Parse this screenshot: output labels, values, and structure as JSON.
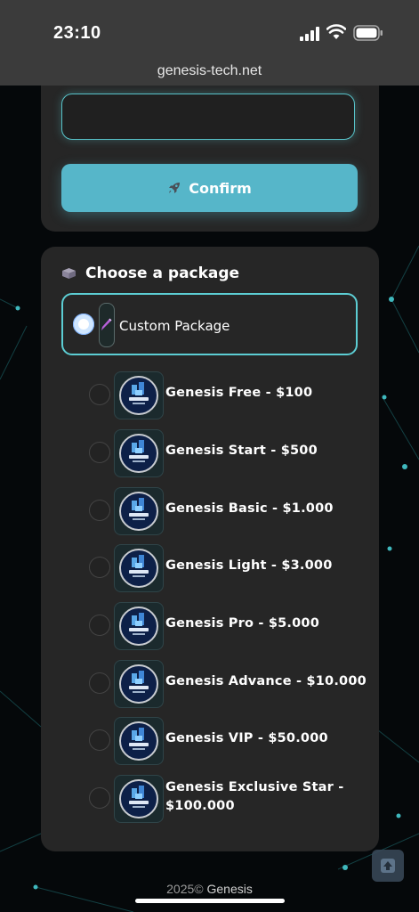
{
  "status_bar": {
    "time": "23:10"
  },
  "browser": {
    "url": "genesis-tech.net"
  },
  "form": {
    "amount_value": "",
    "confirm_label": "Confirm"
  },
  "packages": {
    "title": "Choose a package",
    "custom": {
      "label": "Custom Package",
      "selected": true
    },
    "items": [
      {
        "name": "Genesis Free - $100",
        "selected": false
      },
      {
        "name": "Genesis Start - $500",
        "selected": false
      },
      {
        "name": "Genesis Basic - $1.000",
        "selected": false
      },
      {
        "name": "Genesis Light - $3.000",
        "selected": false
      },
      {
        "name": "Genesis Pro - $5.000",
        "selected": false
      },
      {
        "name": "Genesis Advance - $10.000",
        "selected": false
      },
      {
        "name": "Genesis VIP - $50.000",
        "selected": false
      },
      {
        "name": "Genesis Exclusive Star - $100.000",
        "selected": false
      }
    ]
  },
  "footer": {
    "year": "2025©",
    "brand": "Genesis"
  },
  "colors": {
    "accent": "#56b6c9",
    "card": "#262626",
    "background": "#05080a"
  }
}
